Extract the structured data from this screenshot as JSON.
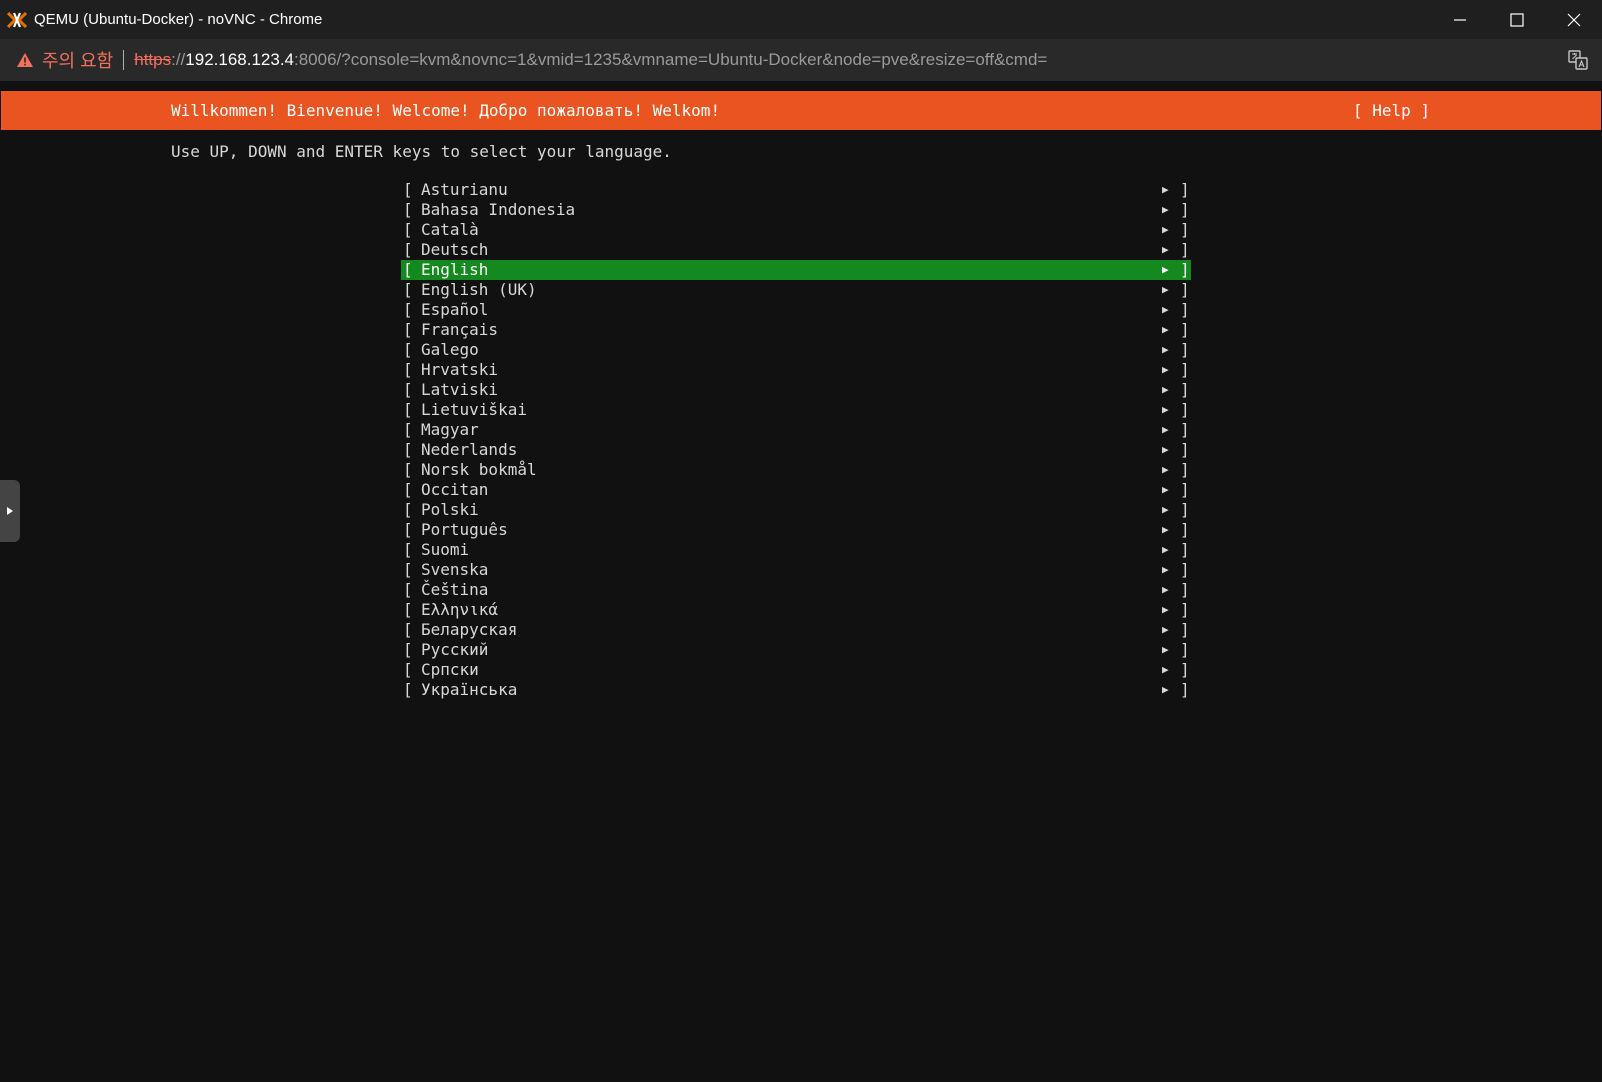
{
  "window": {
    "title": "QEMU (Ubuntu-Docker) - noVNC - Chrome"
  },
  "addressbar": {
    "security_warning": "주의 요함",
    "url_scheme": "https",
    "url_sep": "://",
    "url_host": "192.168.123.4",
    "url_rest": ":8006/?console=kvm&novnc=1&vmid=1235&vmname=Ubuntu-Docker&node=pve&resize=off&cmd="
  },
  "installer": {
    "banner": "Willkommen! Bienvenue! Welcome! Добро пожаловать! Welkom!",
    "help": "[ Help ]",
    "instructions": "Use UP, DOWN and ENTER keys to select your language.",
    "selected_index": 4,
    "colors": {
      "banner": "#e95420",
      "selected": "#148a1e",
      "background": "#111111"
    },
    "languages": [
      "Asturianu",
      "Bahasa Indonesia",
      "Català",
      "Deutsch",
      "English",
      "English (UK)",
      "Español",
      "Français",
      "Galego",
      "Hrvatski",
      "Latviski",
      "Lietuviškai",
      "Magyar",
      "Nederlands",
      "Norsk bokmål",
      "Occitan",
      "Polski",
      "Português",
      "Suomi",
      "Svenska",
      "Čeština",
      "Ελληνικά",
      "Беларуская",
      "Русский",
      "Српски",
      "Українська"
    ]
  },
  "icons": {
    "app": "proxmox-logo",
    "warning": "warning-triangle-icon",
    "translate": "translate-icon",
    "side_handle": "expand-arrow-icon"
  }
}
